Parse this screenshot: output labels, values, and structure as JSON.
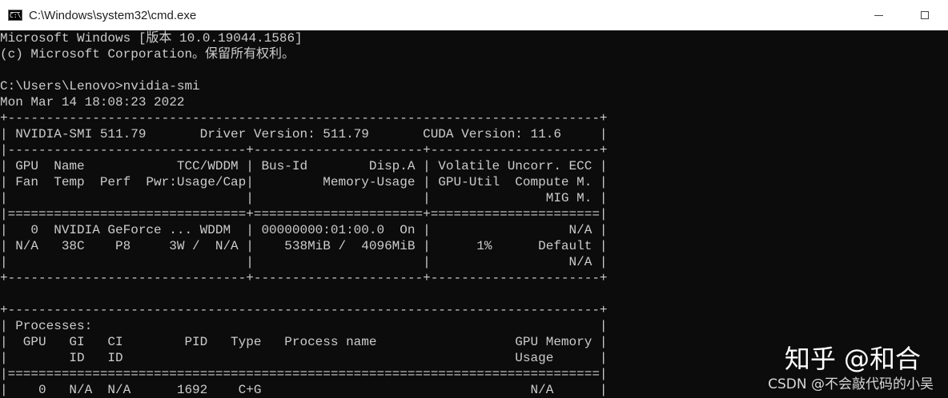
{
  "window": {
    "title": "C:\\Windows\\system32\\cmd.exe",
    "icon": "cmd-icon",
    "controls": [
      "minimize-icon",
      "maximize-icon"
    ]
  },
  "terminal": {
    "lines": [
      "Microsoft Windows [版本 10.0.19044.1586]",
      "(c) Microsoft Corporation。保留所有权利。",
      "",
      "C:\\Users\\Lenovo>nvidia-smi",
      "Mon Mar 14 18:08:23 2022",
      "+-----------------------------------------------------------------------------+",
      "| NVIDIA-SMI 511.79       Driver Version: 511.79       CUDA Version: 11.6     |",
      "|-------------------------------+----------------------+----------------------+",
      "| GPU  Name            TCC/WDDM | Bus-Id        Disp.A | Volatile Uncorr. ECC |",
      "| Fan  Temp  Perf  Pwr:Usage/Cap|         Memory-Usage | GPU-Util  Compute M. |",
      "|                               |                      |               MIG M. |",
      "|===============================+======================+======================|",
      "|   0  NVIDIA GeForce ... WDDM  | 00000000:01:00.0  On |                  N/A |",
      "| N/A   38C    P8     3W /  N/A |    538MiB /  4096MiB |      1%      Default |",
      "|                               |                      |                  N/A |",
      "+-------------------------------+----------------------+----------------------+",
      "",
      "+-----------------------------------------------------------------------------+",
      "| Processes:                                                                  |",
      "|  GPU   GI   CI        PID   Type   Process name                  GPU Memory |",
      "|        ID   ID                                                   Usage      |",
      "|=============================================================================|",
      "|    0   N/A  N/A      1692    C+G                                   N/A      |"
    ]
  },
  "watermark": {
    "brand": "知乎 @和合",
    "credit": "CSDN @不会敲代码的小吴"
  }
}
